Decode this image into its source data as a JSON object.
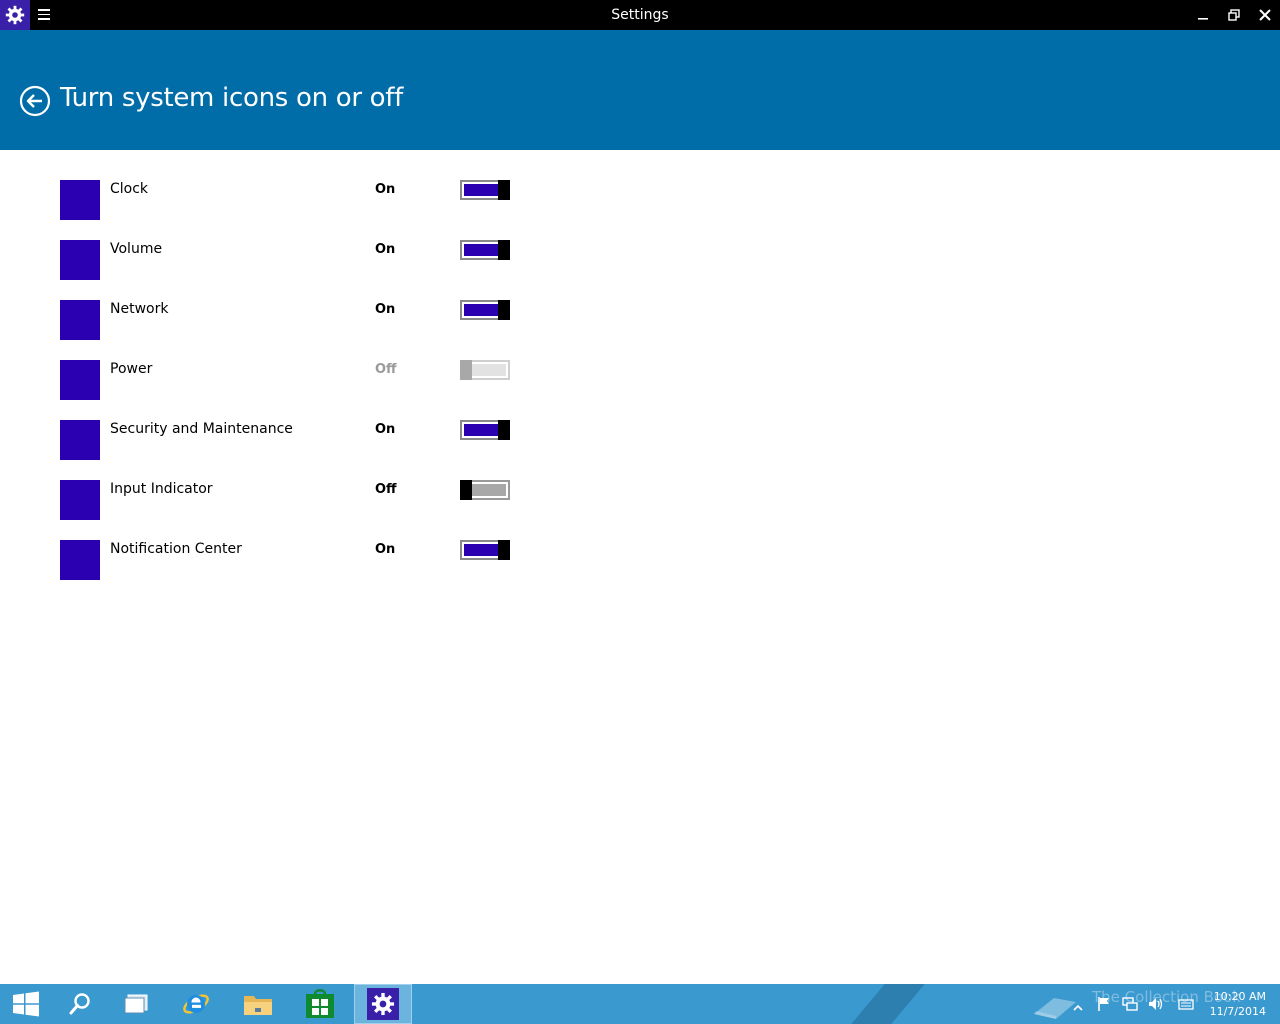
{
  "window": {
    "title": "Settings",
    "icon": "gear-icon",
    "menu_icon": "hamburger-menu-icon",
    "controls": [
      "minimize-icon",
      "restore-icon",
      "close-icon"
    ]
  },
  "header": {
    "title": "Turn system icons on or off",
    "back_icon": "back-arrow-circle-icon",
    "color": "#006ca8"
  },
  "settings": {
    "items": [
      {
        "label": "Clock",
        "state": "On",
        "toggle": "on"
      },
      {
        "label": "Volume",
        "state": "On",
        "toggle": "on"
      },
      {
        "label": "Network",
        "state": "On",
        "toggle": "on"
      },
      {
        "label": "Power",
        "state": "Off",
        "toggle": "disabled"
      },
      {
        "label": "Security and Maintenance",
        "state": "On",
        "toggle": "on"
      },
      {
        "label": "Input Indicator",
        "state": "Off",
        "toggle": "off"
      },
      {
        "label": "Notification Center",
        "state": "On",
        "toggle": "on"
      }
    ],
    "icon_color": "#2a00b0"
  },
  "taskbar": {
    "items": [
      {
        "name": "start-button",
        "icon": "windows-logo-icon"
      },
      {
        "name": "search-button",
        "icon": "search-icon"
      },
      {
        "name": "task-view-button",
        "icon": "task-view-icon"
      },
      {
        "name": "internet-explorer-button",
        "icon": "internet-explorer-icon"
      },
      {
        "name": "file-explorer-button",
        "icon": "folder-icon"
      },
      {
        "name": "store-button",
        "icon": "store-icon"
      },
      {
        "name": "settings-button",
        "icon": "gear-icon",
        "active": true
      }
    ],
    "tray_icons": [
      "show-hidden-icons-icon",
      "action-center-flag-icon",
      "network-icon",
      "volume-icon",
      "keyboard-icon"
    ],
    "time": "10:20 AM",
    "date": "11/7/2014",
    "watermark": "The Collection Book",
    "color": "#3a99cf"
  }
}
